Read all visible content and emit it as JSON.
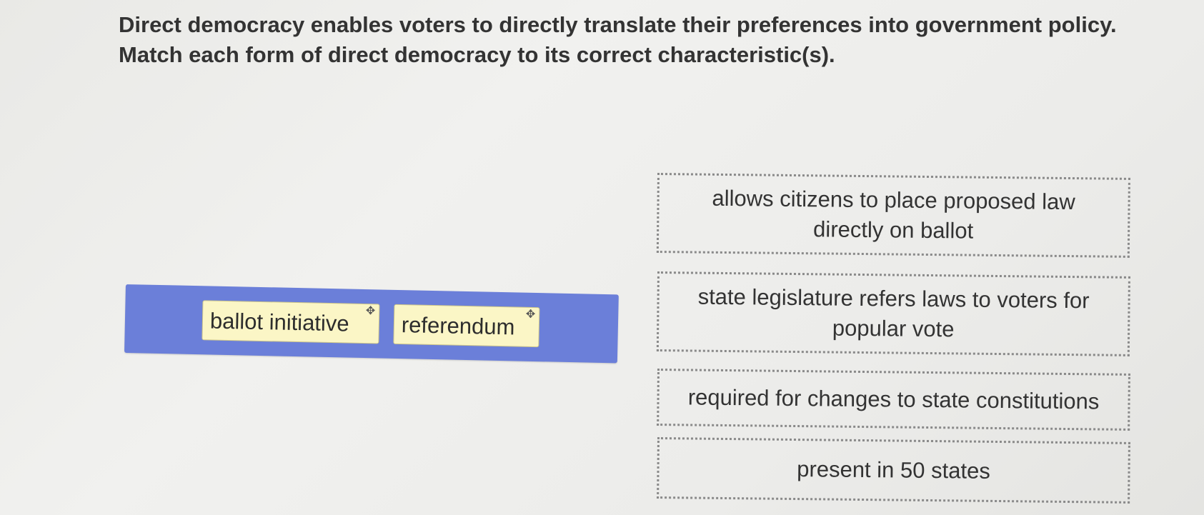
{
  "question": {
    "line1": "Direct democracy enables voters to directly translate their preferences into government policy.",
    "line2": "Match each form of direct democracy to its correct characteristic(s)."
  },
  "answer_bank": {
    "color": "#6b7fd9",
    "items": [
      {
        "label": "ballot initiative",
        "icon": "move-icon"
      },
      {
        "label": "referendum",
        "icon": "move-icon"
      }
    ]
  },
  "targets": [
    {
      "label": "allows citizens to place proposed law directly on ballot"
    },
    {
      "label": "state legislature refers laws to voters for popular vote"
    },
    {
      "label": "required for changes to state constitutions"
    },
    {
      "label": "present in 50 states"
    }
  ]
}
